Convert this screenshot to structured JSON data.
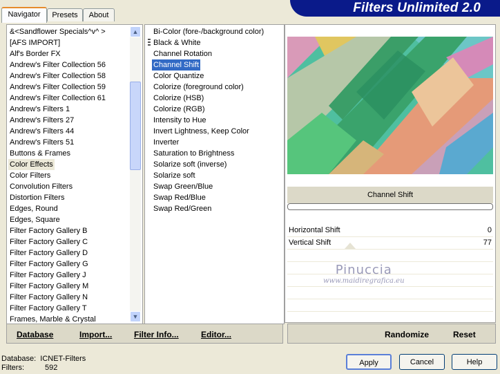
{
  "app_title": "Filters Unlimited 2.0",
  "tabs": [
    {
      "label": "Navigator",
      "active": true
    },
    {
      "label": "Presets",
      "active": false
    },
    {
      "label": "About",
      "active": false
    }
  ],
  "categories": [
    "&<Sandflower Specials^v^ >",
    "[AFS IMPORT]",
    "Alf's Border FX",
    "Andrew's Filter Collection 56",
    "Andrew's Filter Collection 58",
    "Andrew's Filter Collection 59",
    "Andrew's Filter Collection 61",
    "Andrew's Filters 1",
    "Andrew's Filters 27",
    "Andrew's Filters 44",
    "Andrew's Filters 51",
    "Buttons & Frames",
    "Color Effects",
    "Color Filters",
    "Convolution Filters",
    "Distortion Filters",
    "Edges, Round",
    "Edges, Square",
    "Filter Factory Gallery B",
    "Filter Factory Gallery C",
    "Filter Factory Gallery D",
    "Filter Factory Gallery G",
    "Filter Factory Gallery J",
    "Filter Factory Gallery M",
    "Filter Factory Gallery N",
    "Filter Factory Gallery T",
    "Frames, Marble & Crystal"
  ],
  "selected_category": "Color Effects",
  "filters": [
    "Bi-Color (fore-/background color)",
    "Black & White",
    "Channel Rotation",
    "Channel Shift",
    "Color Quantize",
    "Colorize (foreground color)",
    "Colorize (HSB)",
    "Colorize (RGB)",
    "Intensity to Hue",
    "Invert Lightness, Keep Color",
    "Inverter",
    "Saturation to Brightness",
    "Solarize soft (inverse)",
    "Solarize soft",
    "Swap Green/Blue",
    "Swap Red/Blue",
    "Swap Red/Green"
  ],
  "selected_filter": "Channel Shift",
  "preview_label": "Channel Shift",
  "params": [
    {
      "name": "Horizontal Shift",
      "value": "0"
    },
    {
      "name": "Vertical Shift",
      "value": "77"
    }
  ],
  "watermark": {
    "line1": "Pinuccia",
    "line2": "www.maidiregrafica.eu"
  },
  "left_bar": {
    "database": "Database",
    "import": "Import...",
    "filter_info": "Filter Info...",
    "editor": "Editor..."
  },
  "right_bar": {
    "randomize": "Randomize",
    "reset": "Reset"
  },
  "status": {
    "database_label": "Database:",
    "database_value": "ICNET-Filters",
    "filters_label": "Filters:",
    "filters_value": "592"
  },
  "buttons": {
    "apply": "Apply",
    "cancel": "Cancel",
    "help": "Help"
  },
  "colors": {
    "title_banner": "#0a1a8a",
    "selection": "#316ac5",
    "tab_accent": "#e68b2c"
  }
}
